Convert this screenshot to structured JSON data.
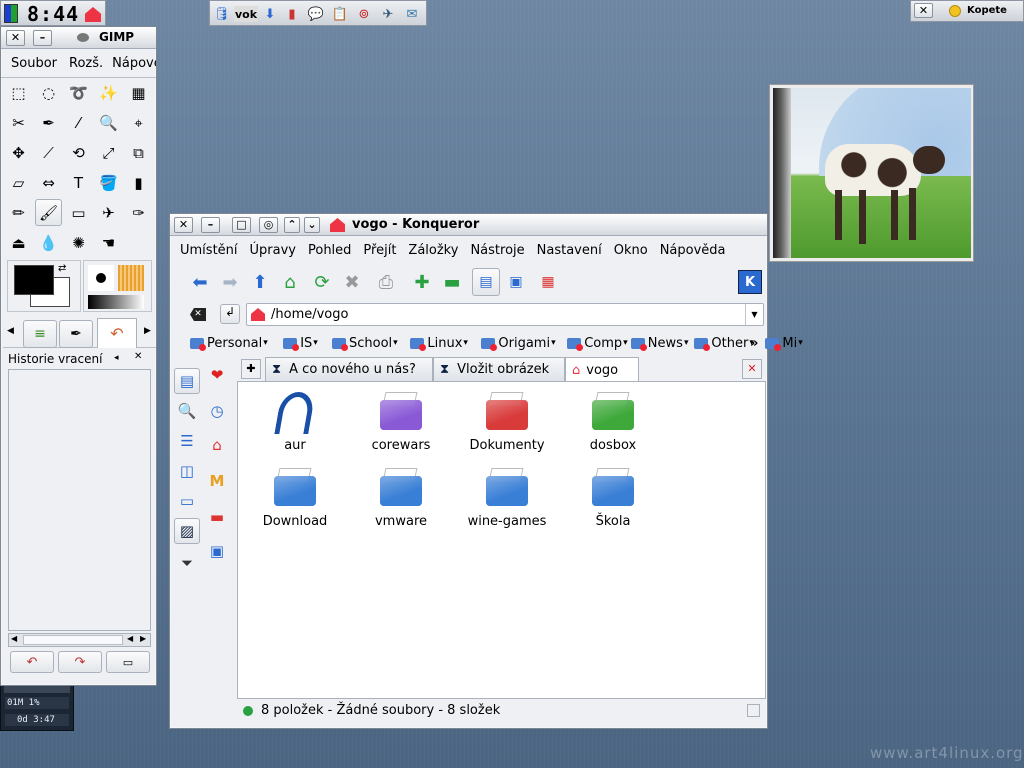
{
  "panel": {
    "clock": "8:44",
    "tray_label": "vok",
    "kopete_label": "Kopete",
    "close_glyph": "✕"
  },
  "gimp": {
    "title": "GIMP",
    "menu": [
      "Soubor",
      "Rozš.",
      "Nápověda"
    ],
    "tools": [
      "rect-select",
      "ellipse-select",
      "lasso",
      "fuzzy-select",
      "by-color-select",
      "scissors",
      "paths",
      "color-picker",
      "zoom",
      "measure",
      "move",
      "crop",
      "rotate",
      "scale",
      "shear",
      "perspective",
      "flip",
      "text",
      "bucket-fill",
      "blend",
      "pencil",
      "paintbrush",
      "eraser",
      "airbrush",
      "ink",
      "clone",
      "blur",
      "dodge",
      "smudge"
    ],
    "tools_glyphs": [
      "⬚",
      "◌",
      "➰",
      "✨",
      "▦",
      "✂",
      "✒",
      "⁄",
      "🔍",
      "⌖",
      "✥",
      "⟋",
      "⟲",
      "⤢",
      "⧉",
      "⏥",
      "⇔",
      "T",
      "🪣",
      "▮",
      "✏",
      "🖌",
      "▭",
      "✈",
      "✑",
      "⏏",
      "💧",
      "✺",
      "☚"
    ],
    "history_title": "Historie vracení",
    "colors": {
      "fg": "#000000",
      "bg": "#ffffff"
    }
  },
  "konqueror": {
    "title": "vogo - Konqueror",
    "menu": [
      "Umístění",
      "Úpravy",
      "Pohled",
      "Přejít",
      "Záložky",
      "Nástroje",
      "Nastavení",
      "Okno",
      "Nápověda"
    ],
    "location": "/home/vogo",
    "bookmarks": [
      "Personal",
      "IS",
      "School",
      "Linux",
      "Origami",
      "Comp",
      "News",
      "Other",
      "Mi"
    ],
    "tabs": [
      "A co nového u nás?",
      "Vložit obrázek",
      "vogo"
    ],
    "files": [
      {
        "name": "aur",
        "kind": "app",
        "color": "#1a4fa8"
      },
      {
        "name": "corewars",
        "kind": "folder",
        "color": "#8a5ad6"
      },
      {
        "name": "Dokumenty",
        "kind": "folder",
        "color": "#d93a3a"
      },
      {
        "name": "dosbox",
        "kind": "folder",
        "color": "#3ea83a"
      },
      {
        "name": "Download",
        "kind": "folder",
        "color": "#3a7fd6"
      },
      {
        "name": "vmware",
        "kind": "folder",
        "color": "#3a7fd6"
      },
      {
        "name": "wine-games",
        "kind": "folder",
        "color": "#3a7fd6"
      },
      {
        "name": "Škola",
        "kind": "folder",
        "color": "#3a7fd6"
      }
    ],
    "status": "8 položek - Žádné soubory - 8 složek"
  },
  "monitor": {
    "line1": "01M 1%",
    "line2": "0d 3:47"
  },
  "watermark": "www.art4linux.org"
}
